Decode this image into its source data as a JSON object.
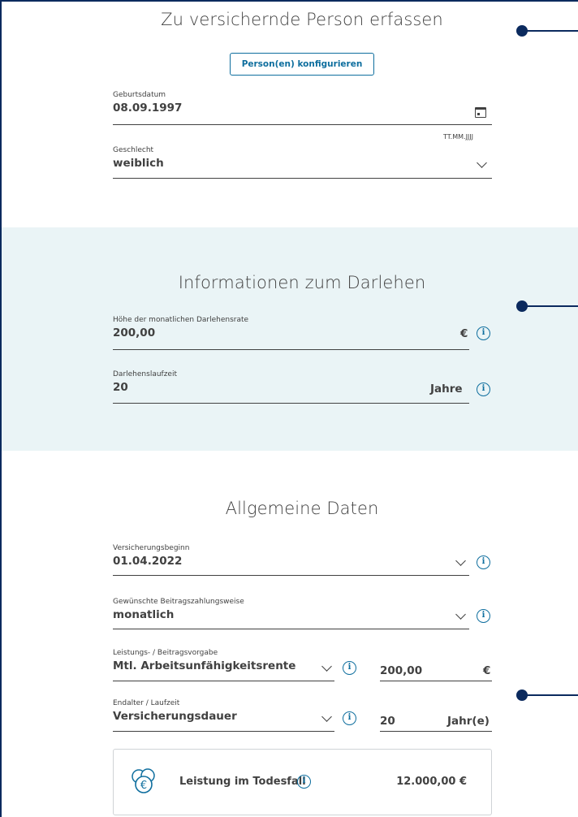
{
  "person_section": {
    "title": "Zu versichernde Person erfassen",
    "configure_button": "Person(en) konfigurieren",
    "birthdate": {
      "label": "Geburtsdatum",
      "value": "08.09.1997",
      "format_hint": "TT.MM.JJJJ"
    },
    "gender": {
      "label": "Geschlecht",
      "value": "weiblich"
    }
  },
  "loan_section": {
    "title": "Informationen zum Darlehen",
    "monthly_rate": {
      "label": "Höhe der monatlichen Darlehensrate",
      "value": "200,00",
      "unit": "€"
    },
    "duration": {
      "label": "Darlehenslaufzeit",
      "value": "20",
      "unit": "Jahre"
    }
  },
  "general_section": {
    "title": "Allgemeine Daten",
    "insurance_start": {
      "label": "Versicherungsbeginn",
      "value": "01.04.2022"
    },
    "payment_mode": {
      "label": "Gewünschte Beitragszahlungsweise",
      "value": "monatlich"
    },
    "benefit": {
      "label": "Leistungs- / Beitragsvorgabe",
      "value": "Mtl. Arbeitsunfähigkeitsrente",
      "amount": "200,00",
      "unit": "€"
    },
    "end_age": {
      "label": "Endalter / Laufzeit",
      "value": "Versicherungsdauer",
      "amount": "20",
      "unit": "Jahr(e)"
    }
  },
  "death_benefit": {
    "label": "Leistung im Todesfall",
    "value": "12.000,00 €"
  },
  "icons": {
    "info": "i",
    "calendar": "calendar-icon",
    "dropdown": "chevron-down-icon",
    "coins": "euro-coins-icon"
  },
  "colors": {
    "accent": "#0e6e9e",
    "connector": "#0b2a5e",
    "section_bg": "#eaf4f6",
    "text": "#414141"
  }
}
